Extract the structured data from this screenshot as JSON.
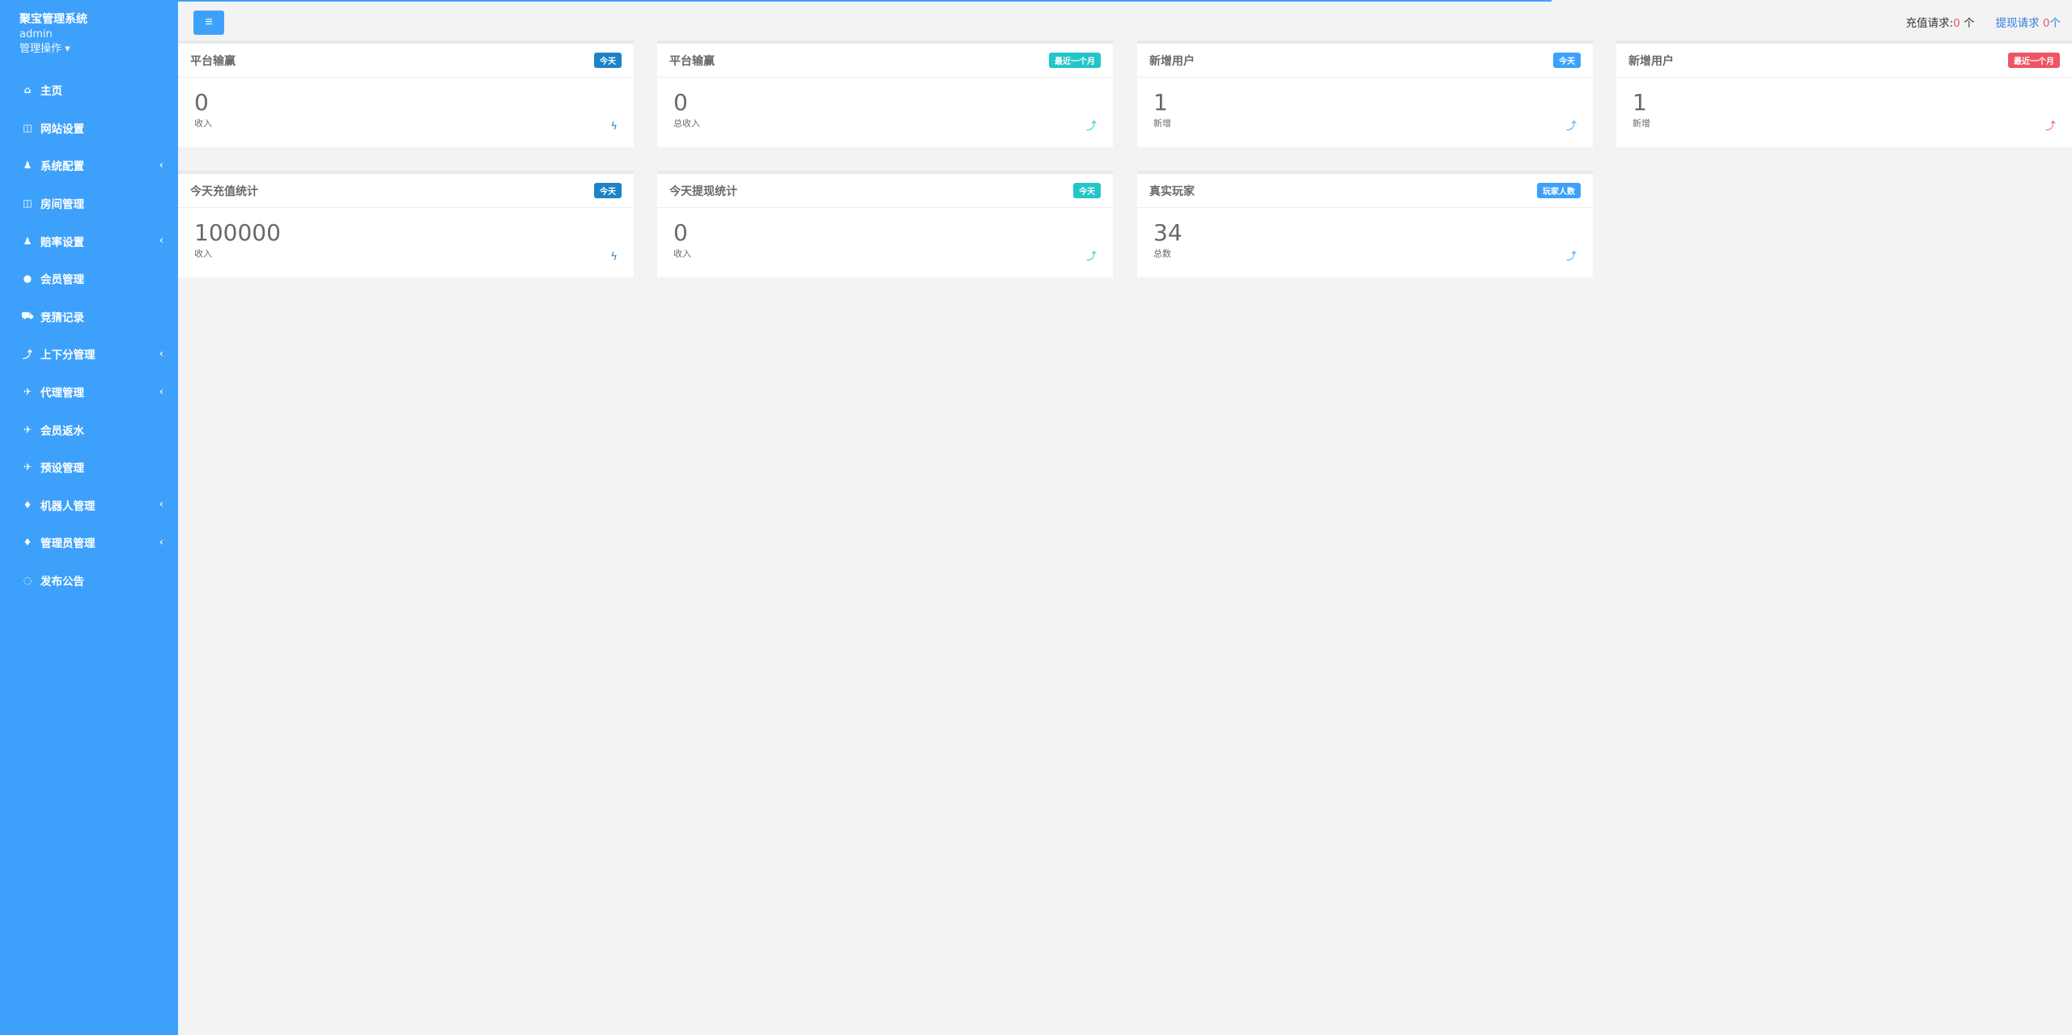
{
  "sidebar": {
    "brand": "聚宝管理系统",
    "user": "admin",
    "ops": "管理操作 ▾",
    "items": [
      {
        "label": "主页",
        "icon": "⌂",
        "chev": ""
      },
      {
        "label": "网站设置",
        "icon": "◫",
        "chev": ""
      },
      {
        "label": "系统配置",
        "icon": "♟",
        "chev": "‹"
      },
      {
        "label": "房间管理",
        "icon": "◫",
        "chev": ""
      },
      {
        "label": "赔率设置",
        "icon": "♟",
        "chev": "‹"
      },
      {
        "label": "会员管理",
        "icon": "●",
        "chev": ""
      },
      {
        "label": "竞猜记录",
        "icon": "⛟",
        "chev": ""
      },
      {
        "label": "上下分管理",
        "icon": "⤴",
        "chev": "‹"
      },
      {
        "label": "代理管理",
        "icon": "✈",
        "chev": "‹"
      },
      {
        "label": "会员返水",
        "icon": "✈",
        "chev": ""
      },
      {
        "label": "预设管理",
        "icon": "✈",
        "chev": ""
      },
      {
        "label": "机器人管理",
        "icon": "♦",
        "chev": "‹"
      },
      {
        "label": "管理员管理",
        "icon": "♦",
        "chev": "‹"
      },
      {
        "label": "发布公告",
        "icon": "◌",
        "chev": ""
      }
    ]
  },
  "topbar": {
    "menu_icon": "≡",
    "recharge_label": "充值请求:",
    "recharge_count": "0",
    "recharge_unit": "个",
    "withdraw_label": "提现请求",
    "withdraw_count": "0",
    "withdraw_unit": "个"
  },
  "cards": [
    {
      "title": "平台输赢",
      "badge": "今天",
      "value": "0",
      "sub": "收入",
      "icon": "ϟ"
    },
    {
      "title": "平台输赢",
      "badge": "最近一个月",
      "value": "0",
      "sub": "总收入",
      "icon": "⤴"
    },
    {
      "title": "新增用户",
      "badge": "今天",
      "value": "1",
      "sub": "新增",
      "icon": "⤴"
    },
    {
      "title": "新增用户",
      "badge": "最近一个月",
      "value": "1",
      "sub": "新增",
      "icon": "⤴"
    },
    {
      "title": "今天充值统计",
      "badge": "今天",
      "value": "100000",
      "sub": "收入",
      "icon": "ϟ"
    },
    {
      "title": "今天提现统计",
      "badge": "今天",
      "value": "0",
      "sub": "收入",
      "icon": "⤴"
    },
    {
      "title": "真实玩家",
      "badge": "玩家人数",
      "value": "34",
      "sub": "总数",
      "icon": "⤴"
    }
  ],
  "colors": {
    "sidebar": "#3da1fb",
    "primary": "#1c84c6",
    "teal": "#23c6c8",
    "danger": "#ed5565"
  }
}
